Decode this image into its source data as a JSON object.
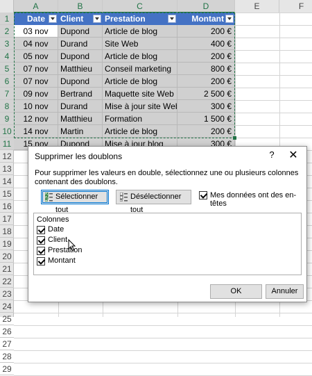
{
  "column_headers": [
    "A",
    "B",
    "C",
    "D",
    "E",
    "F"
  ],
  "row_numbers": [
    "1",
    "2",
    "3",
    "4",
    "5",
    "6",
    "7",
    "8",
    "9",
    "10",
    "11",
    "12",
    "13",
    "14",
    "15",
    "16",
    "17",
    "18",
    "19",
    "20",
    "21",
    "22",
    "23",
    "24",
    "25",
    "26",
    "27",
    "28",
    "29"
  ],
  "table": {
    "headers": [
      "Date",
      "Client",
      "Prestation",
      "Montant"
    ],
    "rows": [
      [
        "03 nov",
        "Dupond",
        "Article de blog",
        "200 €"
      ],
      [
        "04 nov",
        "Durand",
        "Site Web",
        "400 €"
      ],
      [
        "05 nov",
        "Dupond",
        "Article de blog",
        "200 €"
      ],
      [
        "07 nov",
        "Matthieu",
        "Conseil marketing",
        "800 €"
      ],
      [
        "07 nov",
        "Dupond",
        "Article de blog",
        "200 €"
      ],
      [
        "09 nov",
        "Bertrand",
        "Maquette site Web",
        "2 500 €"
      ],
      [
        "10 nov",
        "Durand",
        "Mise à jour site Web",
        "300 €"
      ],
      [
        "12 nov",
        "Matthieu",
        "Formation",
        "1 500 €"
      ],
      [
        "14 nov",
        "Martin",
        "Article de blog",
        "200 €"
      ],
      [
        "15 nov",
        "Dupond",
        "Mise à jour blog",
        "300 €"
      ]
    ]
  },
  "dialog": {
    "title": "Supprimer les doublons",
    "help": "?",
    "close": "✕",
    "description": "Pour supprimer les valeurs en double, sélectionnez une ou plusieurs colonnes contenant des doublons.",
    "select_all_label": "Sélectionner tout",
    "deselect_all_label": "Désélectionner tout",
    "headers_checkbox_label": "Mes données ont des en-têtes",
    "headers_checked": true,
    "columns_group_title": "Colonnes",
    "columns": [
      {
        "label": "Date",
        "checked": true
      },
      {
        "label": "Client",
        "checked": true
      },
      {
        "label": "Prestation",
        "checked": true
      },
      {
        "label": "Montant",
        "checked": true
      }
    ],
    "ok_label": "OK",
    "cancel_label": "Annuler"
  },
  "colors": {
    "table_header": "#4472c4",
    "table_cell": "#d0d0d0",
    "selection": "#217346",
    "primary_button_border": "#0078d7"
  }
}
